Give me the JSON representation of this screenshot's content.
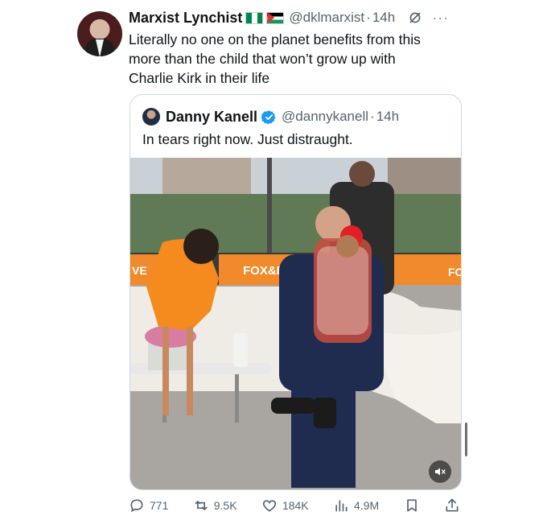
{
  "tweet": {
    "author_name": "Marxist Lynchist",
    "handle": "@dklmarxist",
    "separator": "·",
    "time": "14h",
    "more": "···",
    "text": "Literally no one on the planet benefits from this\nmore than the child that won’t grow up with\nCharlie Kirk in their life",
    "flags": [
      "nigeria-flag",
      "palestine-flag"
    ],
    "colors": {
      "text": "#0f1419",
      "muted": "#536471",
      "verified": "#1d9bf0",
      "border": "#cfd9de"
    }
  },
  "quoted": {
    "author_name": "Danny Kanell",
    "handle": "@dannykanell",
    "separator": "·",
    "time": "14h",
    "verified": true,
    "text": "In tears right now. Just distraught.",
    "media": {
      "type": "video",
      "banner_texts": [
        "VE",
        "FOX&FR",
        "FC"
      ],
      "muted": true
    }
  },
  "actions": {
    "replies": "771",
    "reposts": "9.5K",
    "likes": "184K",
    "views": "4.9M"
  }
}
